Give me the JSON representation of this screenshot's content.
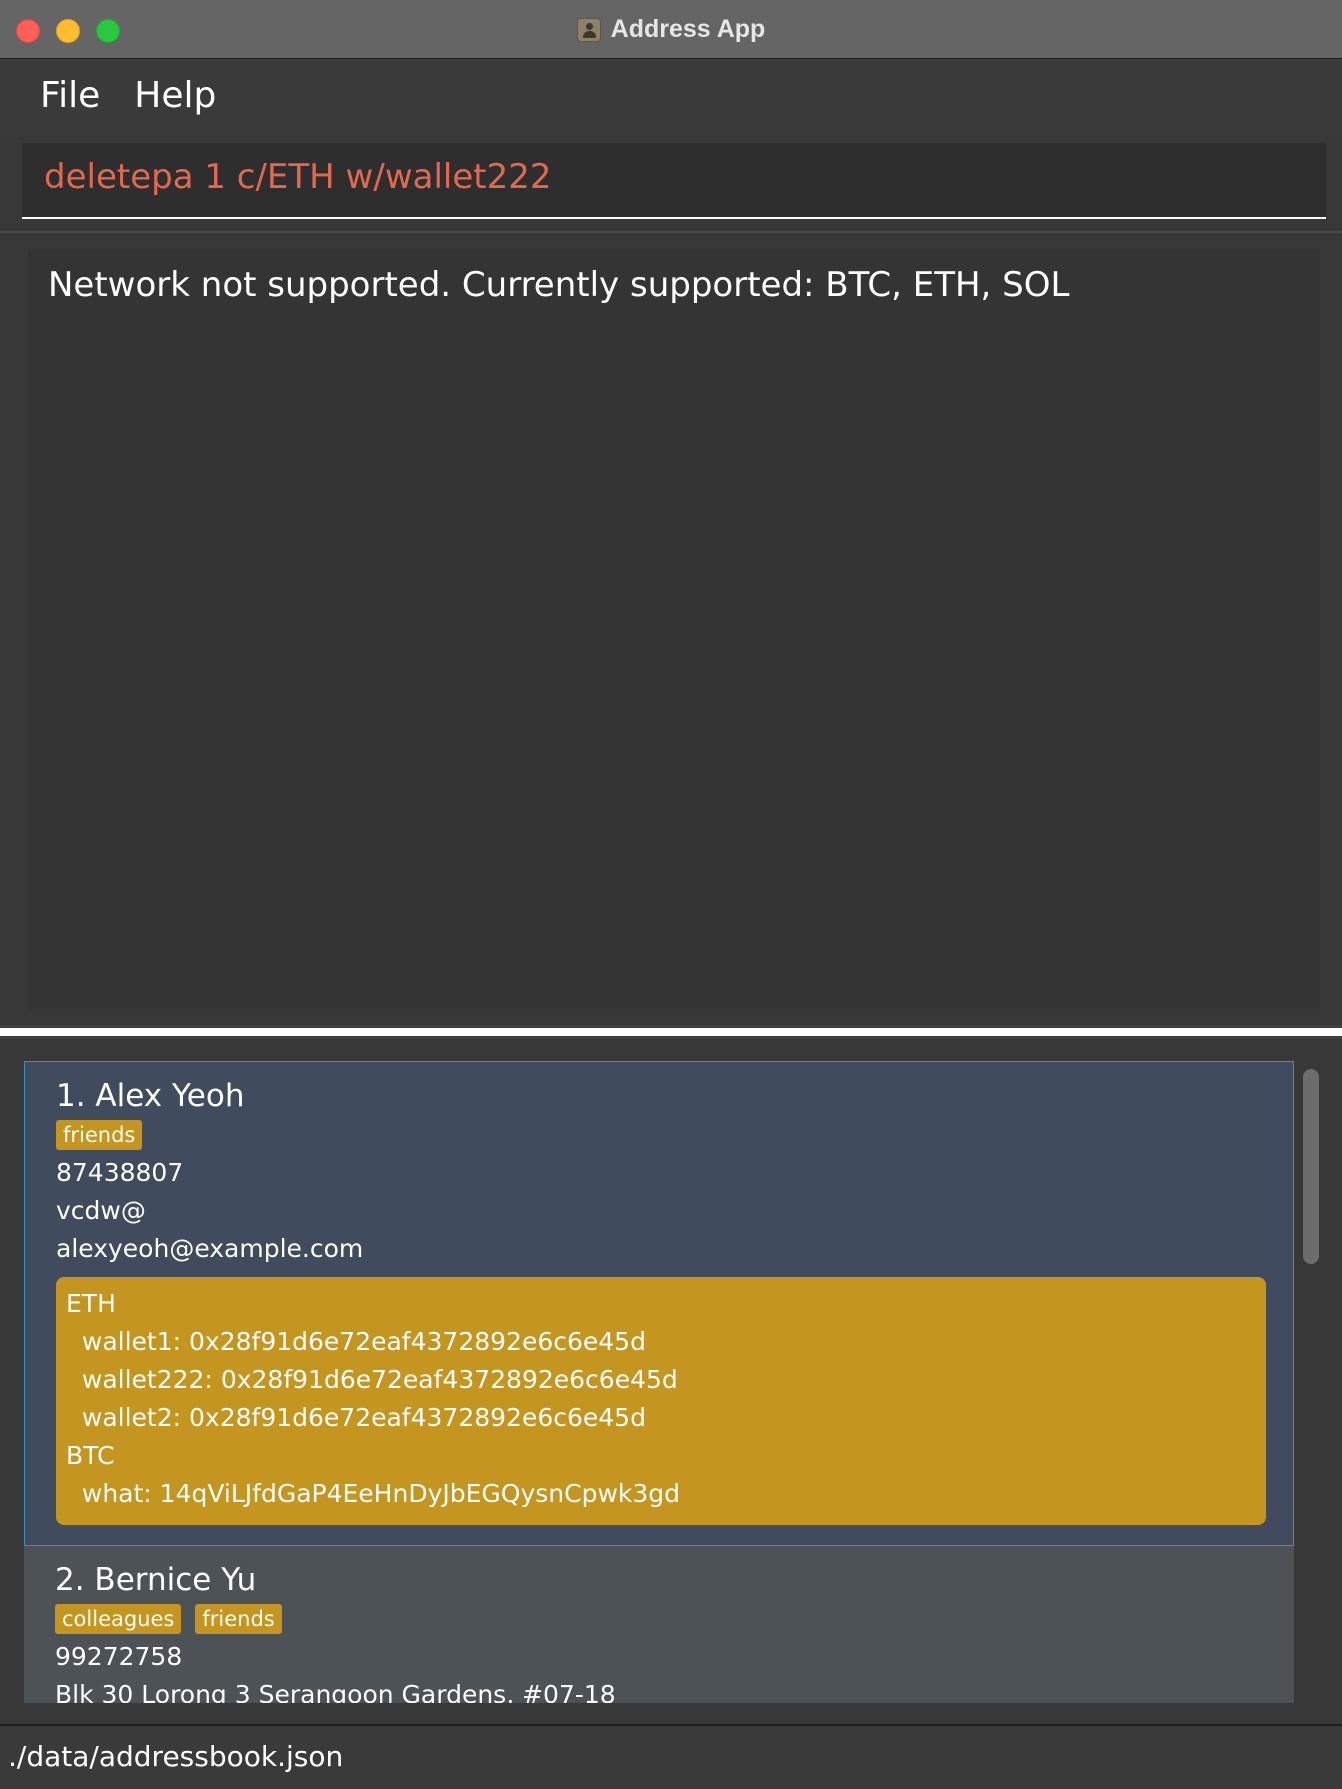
{
  "window": {
    "title": "Address App",
    "controls": [
      "close",
      "minimize",
      "zoom"
    ]
  },
  "menu": {
    "items": [
      "File",
      "Help"
    ]
  },
  "command_box": {
    "value": "deletepa 1 c/ETH w/wallet222",
    "text_color": "#e2694e"
  },
  "result": {
    "message": "Network not supported. Currently supported: BTC, ETH, SOL"
  },
  "persons": [
    {
      "name": "1. Alex Yeoh",
      "tags": [
        "friends"
      ],
      "phone": "87438807",
      "address": "vcdw@",
      "email": "alexyeoh@example.com",
      "wallet_lines": [
        "ETH",
        "  wallet1: 0x28f91d6e72eaf4372892e6c6e45d",
        "  wallet222: 0x28f91d6e72eaf4372892e6c6e45d",
        "  wallet2: 0x28f91d6e72eaf4372892e6c6e45d",
        "BTC",
        "  what: 14qViLJfdGaP4EeHnDyJbEGQysnCpwk3gd"
      ],
      "selected": true
    },
    {
      "name": "2. Bernice Yu",
      "tags": [
        "colleagues",
        "friends"
      ],
      "phone": "99272758",
      "address": "Blk 30 Lorong 3 Serangoon Gardens, #07-18",
      "selected": false
    }
  ],
  "status_bar": {
    "path": "./data/addressbook.json"
  },
  "colors": {
    "tag": "#c4951f",
    "selected_card": "#414b5e",
    "card": "#4d5256",
    "panel": "#383838"
  }
}
